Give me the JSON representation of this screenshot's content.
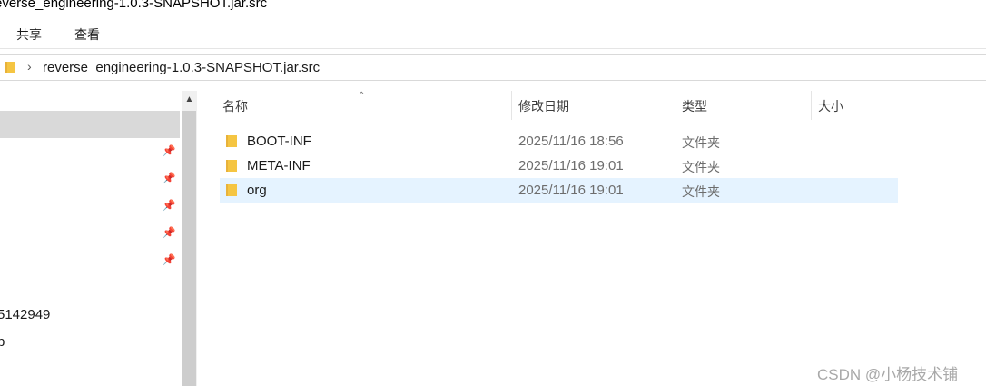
{
  "window": {
    "title": "everse_engineering-1.0.3-SNAPSHOT.jar.src"
  },
  "ribbon": {
    "tabs": [
      {
        "label": "共享"
      },
      {
        "label": "查看"
      }
    ]
  },
  "address": {
    "path": "reverse_engineering-1.0.3-SNAPSHOT.jar.src"
  },
  "nav": {
    "items": [
      {
        "label": "5142949"
      },
      {
        "label": "p"
      }
    ]
  },
  "list": {
    "headers": {
      "name": "名称",
      "modified": "修改日期",
      "type": "类型",
      "size": "大小"
    },
    "rows": [
      {
        "name": "BOOT-INF",
        "modified": "2025/11/16 18:56",
        "type": "文件夹"
      },
      {
        "name": "META-INF",
        "modified": "2025/11/16 19:01",
        "type": "文件夹"
      },
      {
        "name": "org",
        "modified": "2025/11/16 19:01",
        "type": "文件夹"
      }
    ]
  },
  "watermark": "CSDN @小杨技术铺",
  "colors": {
    "folder": "#f5c542",
    "selection": "#e5f3ff",
    "nav_selection": "#d9d9d9"
  }
}
